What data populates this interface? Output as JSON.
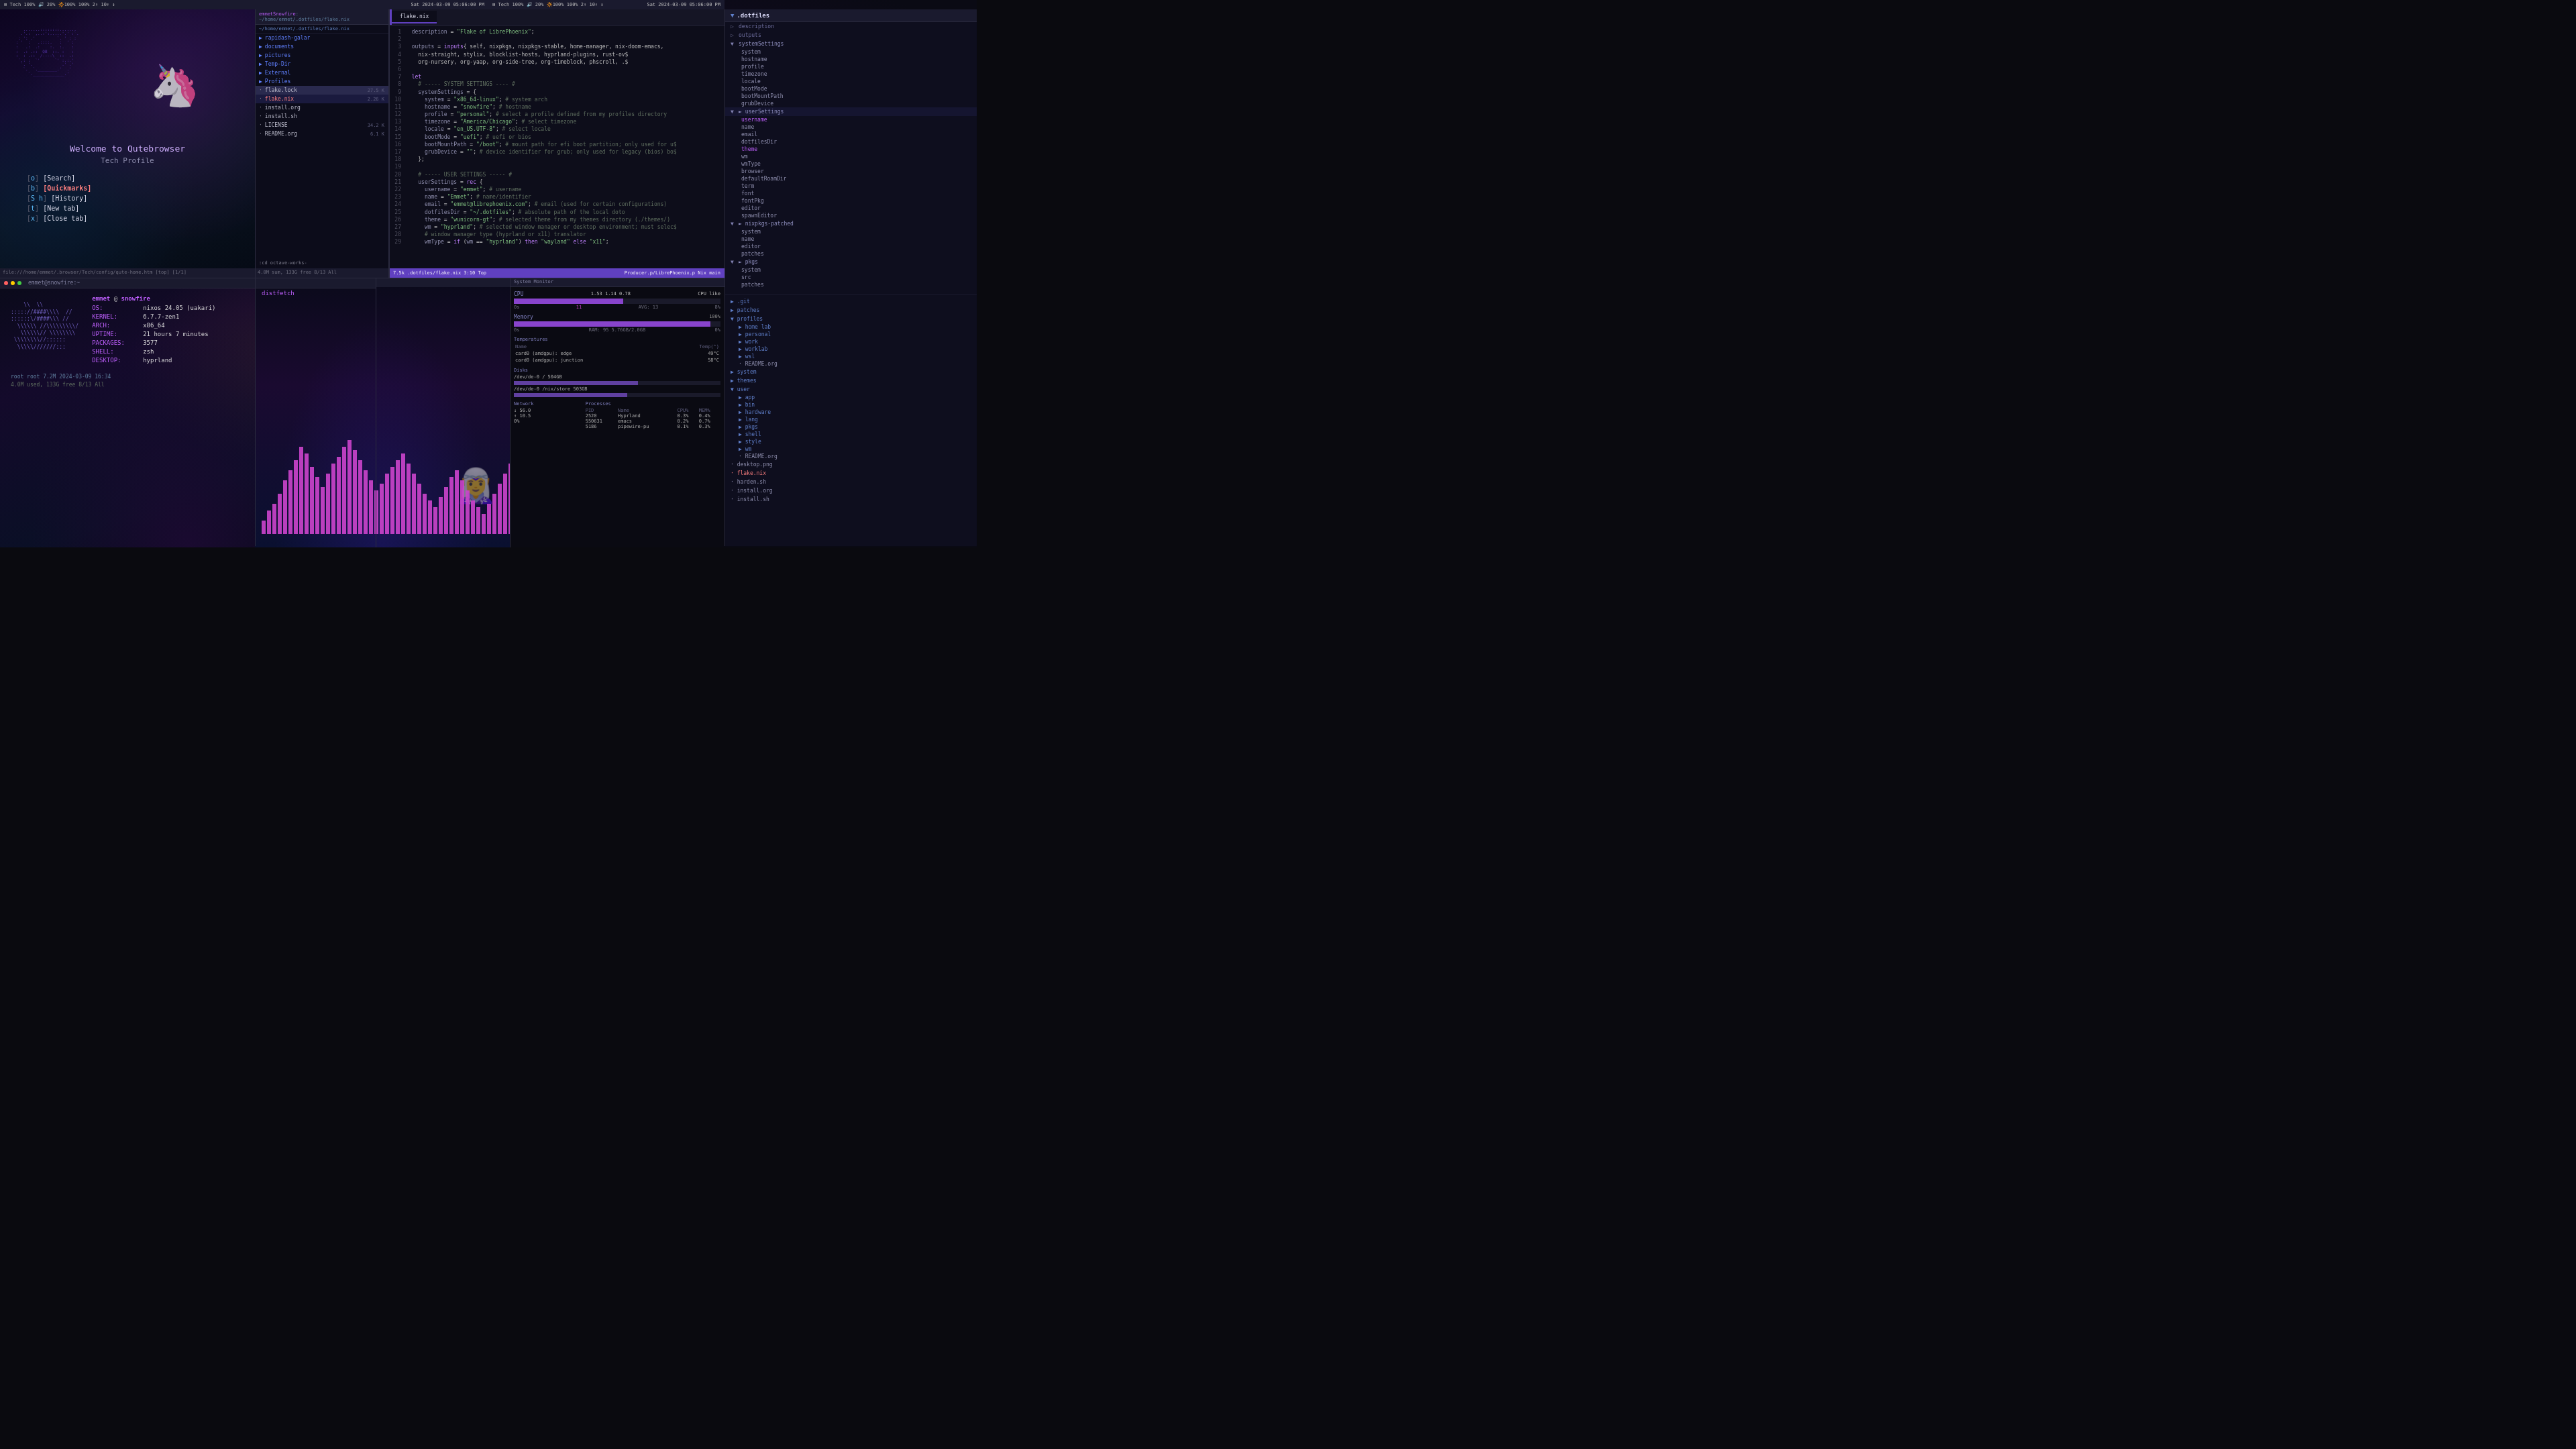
{
  "topbar": {
    "left": "⊞ Tech 100%  🔊 20%  🔆100%  100%  2↑  10↑  ↕",
    "center_left": "Sat 2024-03-09 05:06:00 PM",
    "center_right": "⊞ Tech 100%  🔊 20%  🔆100%  100%  2↑  10↑  ↕",
    "right": "Sat 2024-03-09 05:06:00 PM"
  },
  "qutebrowser": {
    "title": "Welcome to Qutebrowser",
    "subtitle": "Tech Profile",
    "menu": [
      {
        "key": "o",
        "label": "[Search]"
      },
      {
        "key": "b",
        "label": "[Quickmarks]",
        "bold": true
      },
      {
        "key": "S h",
        "label": "[History]"
      },
      {
        "key": "t",
        "label": "[New tab]"
      },
      {
        "key": "x",
        "label": "[Close tab]"
      }
    ],
    "statusbar": "file:///home/emmet/.browser/Tech/config/qute-home.htm [top] [1/1]"
  },
  "file_manager": {
    "header": "emmetSnowfire: ~/home/emmet/.dotfiles/flake.nix",
    "path": "~/home/emmet/.dotfiles/flake.nix",
    "items": [
      {
        "name": "rapidash-galar",
        "type": "folder",
        "level": 0
      },
      {
        "name": "documents",
        "type": "folder",
        "level": 0
      },
      {
        "name": "pictures",
        "type": "folder",
        "level": 0
      },
      {
        "name": "Temp-Dir",
        "type": "folder",
        "level": 0
      },
      {
        "name": "External",
        "type": "folder",
        "level": 0
      },
      {
        "name": "Profiles",
        "type": "folder",
        "level": 0
      },
      {
        "name": "flake.lock",
        "type": "file",
        "size": "27.5 K",
        "level": 0,
        "selected": true
      },
      {
        "name": "flake.nix",
        "type": "file",
        "size": "2.26 K",
        "level": 0,
        "highlighted": true
      },
      {
        "name": "install.org",
        "type": "file",
        "size": "",
        "level": 0
      },
      {
        "name": "install.sh",
        "type": "file",
        "size": "",
        "level": 0
      },
      {
        "name": "LICENSE",
        "type": "file",
        "size": "34.2 K",
        "level": 0
      },
      {
        "name": "README.org",
        "type": "file",
        "size": "6.1 K",
        "level": 0
      }
    ]
  },
  "code_editor": {
    "filename": "flake.nix",
    "tabs": [
      "flake.nix"
    ],
    "lines": [
      {
        "num": 1,
        "content": "  description = \"Flake of LibrePhoenix\";"
      },
      {
        "num": 2,
        "content": ""
      },
      {
        "num": 3,
        "content": "  outputs = inputs{ self, nixpkgs, nixpkgs-stable, home-manager, nix-doom-emacs,"
      },
      {
        "num": 4,
        "content": "    nix-straight, stylix, blocklist-hosts, hyprland-plugins, rust-ov$"
      },
      {
        "num": 5,
        "content": "    org-nursery, org-yaap, org-side-tree, org-timeblock, phscroll, .$"
      },
      {
        "num": 6,
        "content": ""
      },
      {
        "num": 7,
        "content": "  let"
      },
      {
        "num": 8,
        "content": "    # ----- SYSTEM SETTINGS ---- #"
      },
      {
        "num": 9,
        "content": "    systemSettings = {"
      },
      {
        "num": 10,
        "content": "      system = \"x86_64-linux\"; # system arch"
      },
      {
        "num": 11,
        "content": "      hostname = \"snowfire\"; # hostname"
      },
      {
        "num": 12,
        "content": "      profile = \"personal\"; # select a profile defined from my profiles directory"
      },
      {
        "num": 13,
        "content": "      timezone = \"America/Chicago\"; # select timezone"
      },
      {
        "num": 14,
        "content": "      locale = \"en_US.UTF-8\"; # select locale"
      },
      {
        "num": 15,
        "content": "      bootMode = \"uefi\"; # uefi or bios"
      },
      {
        "num": 16,
        "content": "      bootMountPath = \"/boot\"; # mount path for efi boot partition; only used for u$"
      },
      {
        "num": 17,
        "content": "      grubDevice = \"\"; # device identifier for grub; only used for legacy (bios) bo$"
      },
      {
        "num": 18,
        "content": "    };"
      },
      {
        "num": 19,
        "content": ""
      },
      {
        "num": 20,
        "content": "    # ----- USER SETTINGS ----- #"
      },
      {
        "num": 21,
        "content": "    userSettings = rec {"
      },
      {
        "num": 22,
        "content": "      username = \"emmet\"; # username"
      },
      {
        "num": 23,
        "content": "      name = \"Emmet\"; # name/identifier"
      },
      {
        "num": 24,
        "content": "      email = \"emmet@librephoenix.com\"; # email (used for certain configurations)"
      },
      {
        "num": 25,
        "content": "      dotfilesDir = \"~/.dotfiles\"; # absolute path of the dotfiles"
      },
      {
        "num": 26,
        "content": "      theme = \"wunicorn-gt\"; # selected theme from my themes directory (./themes/)"
      },
      {
        "num": 27,
        "content": "      wm = \"hyprland\"; # selected window manager or desktop environment; must selec$"
      },
      {
        "num": 28,
        "content": "      # window manager type (hyprland or x11) translator"
      },
      {
        "num": 29,
        "content": "      wmType = if (wm == \"hyprland\") then \"wayland\" else \"x11\";"
      }
    ],
    "statusbar": {
      "left": "7.5k  .dotfiles/flake.nix  3:10  Top",
      "right": "Producer.p/LibrePhoenix.p  Nix  main"
    }
  },
  "file_tree": {
    "root": ".dotfiles",
    "sections": [
      {
        "name": "description",
        "items": []
      },
      {
        "name": "outputs",
        "items": []
      },
      {
        "name": "systemSettings",
        "expanded": true,
        "items": [
          "system",
          "hostname",
          "profile",
          "timezone",
          "locale",
          "bootMode",
          "bootMountPath",
          "grubDevice"
        ]
      },
      {
        "name": "userSettings",
        "expanded": true,
        "items": [
          "username",
          "name",
          "email",
          "dotfilesDir",
          "theme",
          "wm",
          "wmType",
          "browser",
          "defaultRoamDir",
          "term",
          "font",
          "fontPkg",
          "editor",
          "spawnEditor"
        ]
      },
      {
        "name": "nixpkgs-patched",
        "expanded": true,
        "items": [
          "system",
          "name",
          "editor",
          "patches"
        ]
      },
      {
        "name": "pkgs",
        "expanded": true,
        "items": [
          "system",
          "src",
          "patches"
        ]
      }
    ],
    "folders": [
      ".git",
      "patches",
      "profiles",
      "home lab",
      "personal",
      "work",
      "worklab",
      "wsl",
      "README.org",
      "system",
      "themes",
      "user",
      "app",
      "bin",
      "hardware",
      "lang",
      "pkgs",
      "shell",
      "style",
      "wm",
      "README.org"
    ],
    "files": [
      "flake.lock",
      "flake.nix",
      "harden.sh",
      "install.org",
      "install.sh",
      "README.org",
      "desktop.png"
    ]
  },
  "terminal": {
    "header": "emmet@snowfire:~",
    "prompt": "root root 7.2M 2024-03-09 16:34",
    "disk_info": "4.0M used, 133G free  8/13  All"
  },
  "neofetch": {
    "user": "emmet @ snowfire",
    "os": "nixos 24.05 (uakari)",
    "kernel": "6.7.7-zen1",
    "arch": "x86_64",
    "uptime": "21 hours 7 minutes",
    "packages": "3577",
    "shell": "zsh",
    "desktop": "hyprland",
    "logo_text": "nixos"
  },
  "sysmon": {
    "cpu_label": "CPU",
    "cpu_usage": 53,
    "cpu_values": "1.53 1.14 0.78",
    "cpu_avg": 13,
    "cpu_max": 8,
    "memory": {
      "label": "Memory",
      "percent": 95,
      "used": "5.76GB",
      "total": "2.0GB"
    },
    "temperatures": {
      "label": "Temperatures",
      "entries": [
        {
          "name": "card0 (amdgpu): edge",
          "temp": "49°C"
        },
        {
          "name": "card0 (amdgpu): junction",
          "temp": "58°C"
        }
      ]
    },
    "disks": {
      "label": "Disks",
      "entries": [
        {
          "path": "/dev/de-0 /",
          "size": "504GB"
        },
        {
          "path": "/dev/de-0 /nix/store",
          "size": "503GB"
        }
      ]
    },
    "network": {
      "label": "Network",
      "down": "56.0",
      "up": "10.5",
      "idle": "0%"
    },
    "processes": {
      "label": "Processes",
      "entries": [
        {
          "pid": "2520",
          "name": "Hyprland",
          "cpu": "0.3%",
          "mem": "0.4%"
        },
        {
          "pid": "550631",
          "name": "emacs",
          "cpu": "0.2%",
          "mem": "0.7%"
        },
        {
          "pid": "5186",
          "name": "pipewire-pu",
          "cpu": "0.1%",
          "mem": "0.3%"
        }
      ]
    }
  },
  "visualizer": {
    "bar_heights": [
      20,
      35,
      45,
      60,
      80,
      95,
      110,
      130,
      120,
      100,
      85,
      70,
      90,
      105,
      115,
      130,
      140,
      125,
      110,
      95,
      80,
      65,
      75,
      90,
      100,
      110,
      120,
      105,
      90,
      75,
      60,
      50,
      40,
      55,
      70,
      85,
      95,
      80,
      65,
      50,
      40,
      30,
      45,
      60,
      75,
      90,
      105,
      120,
      130,
      110
    ]
  }
}
